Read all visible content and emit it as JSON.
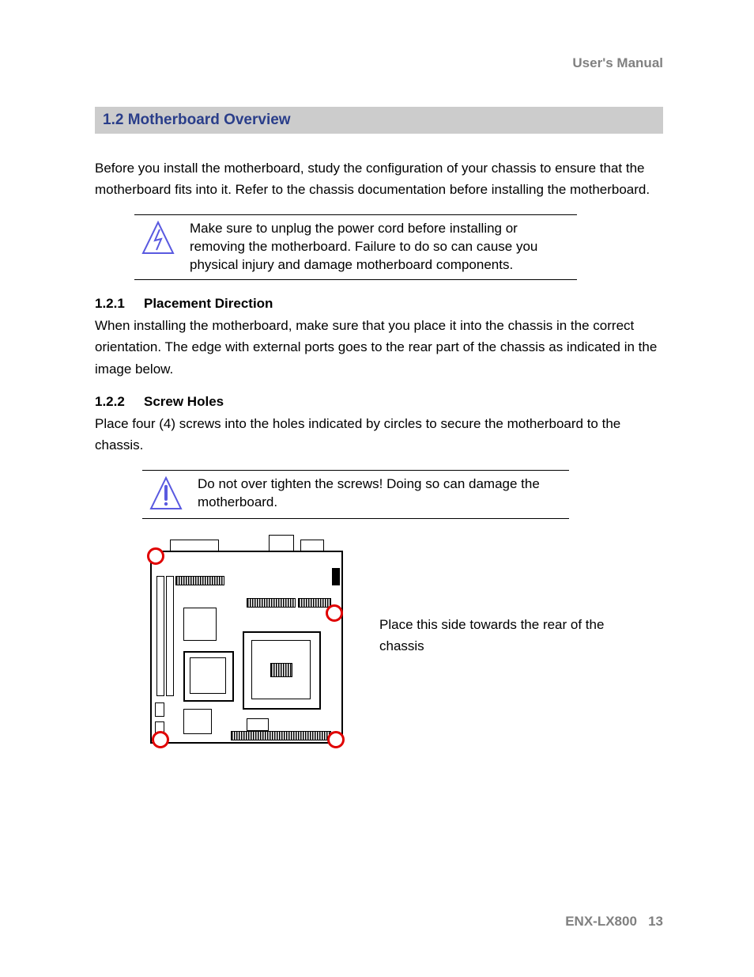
{
  "header": {
    "right": "User's Manual"
  },
  "section": {
    "title": "1.2 Motherboard Overview"
  },
  "intro": "Before you install the motherboard, study the configuration of your chassis to ensure that the motherboard fits into it. Refer to the chassis documentation before installing the motherboard.",
  "callout1": {
    "icon": "lightning-warning-icon",
    "text": "Make sure to unplug the power cord before installing or removing the motherboard. Failure to do so can cause you physical injury and damage motherboard components."
  },
  "sub1": {
    "num": "1.2.1",
    "title": "Placement Direction",
    "text": "When installing the motherboard, make sure that you place it into the chassis in the correct orientation. The edge with external ports goes to the rear part of the chassis as indicated in the image below."
  },
  "sub2": {
    "num": "1.2.2",
    "title": "Screw Holes",
    "text": "Place four (4) screws into the holes indicated by circles to secure the motherboard to the chassis."
  },
  "callout2": {
    "icon": "exclamation-warning-icon",
    "text": "Do not over tighten the screws! Doing so can damage the motherboard."
  },
  "diagram": {
    "caption": "Place this side towards the rear of the chassis"
  },
  "footer": {
    "model": "ENX-LX800",
    "page": "13"
  }
}
